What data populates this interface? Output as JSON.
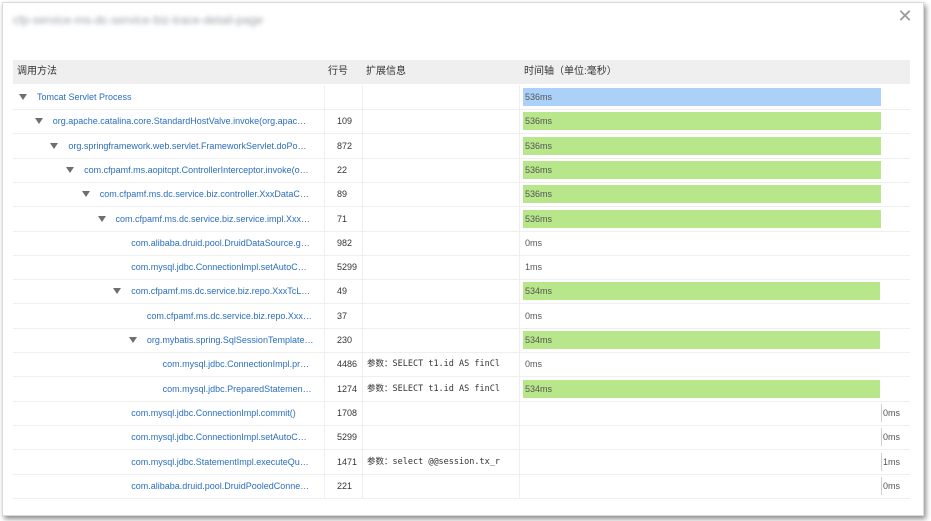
{
  "window": {
    "title": "cfp-service-ms-dc-service-biz-trace-detail-page"
  },
  "header": {
    "method": "调用方法",
    "line": "行号",
    "ext": "扩展信息",
    "time": "时间轴（单位:毫秒）"
  },
  "colors": {
    "root_bar": "#abd1f9",
    "bar": "#b8e68b",
    "link": "#2a6ebd"
  },
  "rows": [
    {
      "name": "Tomcat Servlet Process",
      "line": "",
      "ext": "",
      "time": "536ms",
      "ms": 536,
      "depth": 0,
      "expand": true,
      "bar": "root"
    },
    {
      "name": "org.apache.catalina.core.StandardHostValve.invoke(org.apac…",
      "line": "109",
      "ext": "",
      "time": "536ms",
      "ms": 536,
      "depth": 1,
      "expand": true,
      "bar": "normal"
    },
    {
      "name": "org.springframework.web.servlet.FrameworkServlet.doPo…",
      "line": "872",
      "ext": "",
      "time": "536ms",
      "ms": 536,
      "depth": 2,
      "expand": true,
      "bar": "normal"
    },
    {
      "name": "com.cfpamf.ms.aopitcpt.ControllerInterceptor.invoke(o…",
      "line": "22",
      "ext": "",
      "time": "536ms",
      "ms": 536,
      "depth": 3,
      "expand": true,
      "bar": "normal"
    },
    {
      "name": "com.cfpamf.ms.dc.service.biz.controller.XxxDataC…",
      "line": "89",
      "ext": "",
      "time": "536ms",
      "ms": 536,
      "depth": 4,
      "expand": true,
      "bar": "normal"
    },
    {
      "name": "com.cfpamf.ms.dc.service.biz.service.impl.Xxx…",
      "line": "71",
      "ext": "",
      "time": "536ms",
      "ms": 536,
      "depth": 5,
      "expand": true,
      "bar": "normal"
    },
    {
      "name": "com.alibaba.druid.pool.DruidDataSource.g…",
      "line": "982",
      "ext": "",
      "time": "0ms",
      "ms": 0,
      "depth": 6,
      "expand": false,
      "bar": "none"
    },
    {
      "name": "com.mysql.jdbc.ConnectionImpl.setAutoC…",
      "line": "5299",
      "ext": "",
      "time": "1ms",
      "ms": 1,
      "depth": 6,
      "expand": false,
      "bar": "none"
    },
    {
      "name": "com.cfpamf.ms.dc.service.biz.repo.XxxTcL…",
      "line": "49",
      "ext": "",
      "time": "534ms",
      "ms": 534,
      "depth": 6,
      "expand": true,
      "bar": "normal"
    },
    {
      "name": "com.cfpamf.ms.dc.service.biz.repo.Xxx…",
      "line": "37",
      "ext": "",
      "time": "0ms",
      "ms": 0,
      "depth": 7,
      "expand": false,
      "bar": "none"
    },
    {
      "name": "org.mybatis.spring.SqlSessionTemplate…",
      "line": "230",
      "ext": "",
      "time": "534ms",
      "ms": 534,
      "depth": 7,
      "expand": true,
      "bar": "normal"
    },
    {
      "name": "com.mysql.jdbc.ConnectionImpl.pr…",
      "line": "4486",
      "ext": "参数：SELECT t1.id AS finCl",
      "time": "0ms",
      "ms": 0,
      "depth": 8,
      "expand": false,
      "bar": "none"
    },
    {
      "name": "com.mysql.jdbc.PreparedStatemen…",
      "line": "1274",
      "ext": "参数：SELECT t1.id AS finCl",
      "time": "534ms",
      "ms": 534,
      "depth": 8,
      "expand": false,
      "bar": "normal"
    },
    {
      "name": "com.mysql.jdbc.ConnectionImpl.commit()",
      "line": "1708",
      "ext": "",
      "time": "0ms",
      "ms": 0,
      "depth": 6,
      "expand": false,
      "bar": "end"
    },
    {
      "name": "com.mysql.jdbc.ConnectionImpl.setAutoC…",
      "line": "5299",
      "ext": "",
      "time": "0ms",
      "ms": 0,
      "depth": 6,
      "expand": false,
      "bar": "end"
    },
    {
      "name": "com.mysql.jdbc.StatementImpl.executeQu…",
      "line": "1471",
      "ext": "参数：select @@session.tx_r",
      "time": "1ms",
      "ms": 1,
      "depth": 6,
      "expand": false,
      "bar": "end"
    },
    {
      "name": "com.alibaba.druid.pool.DruidPooledConne…",
      "line": "221",
      "ext": "",
      "time": "0ms",
      "ms": 0,
      "depth": 6,
      "expand": false,
      "bar": "end"
    }
  ]
}
